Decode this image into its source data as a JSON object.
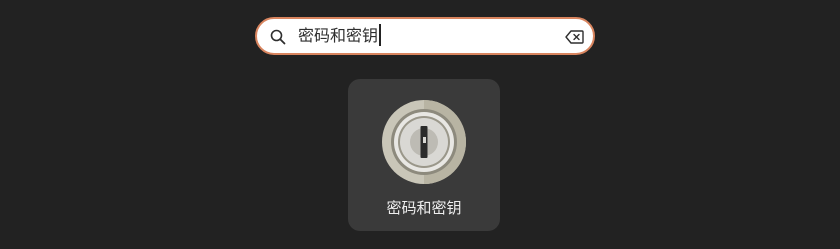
{
  "search": {
    "query": "密码和密钥",
    "icon": "search-icon",
    "clear_icon": "backspace-clear-icon"
  },
  "results": [
    {
      "label": "密码和密钥",
      "icon": "keyring-icon"
    }
  ],
  "colors": {
    "background": "#222222",
    "search_border": "#d9855f",
    "tile": "#3a3a3a",
    "label": "#eeeeee"
  }
}
